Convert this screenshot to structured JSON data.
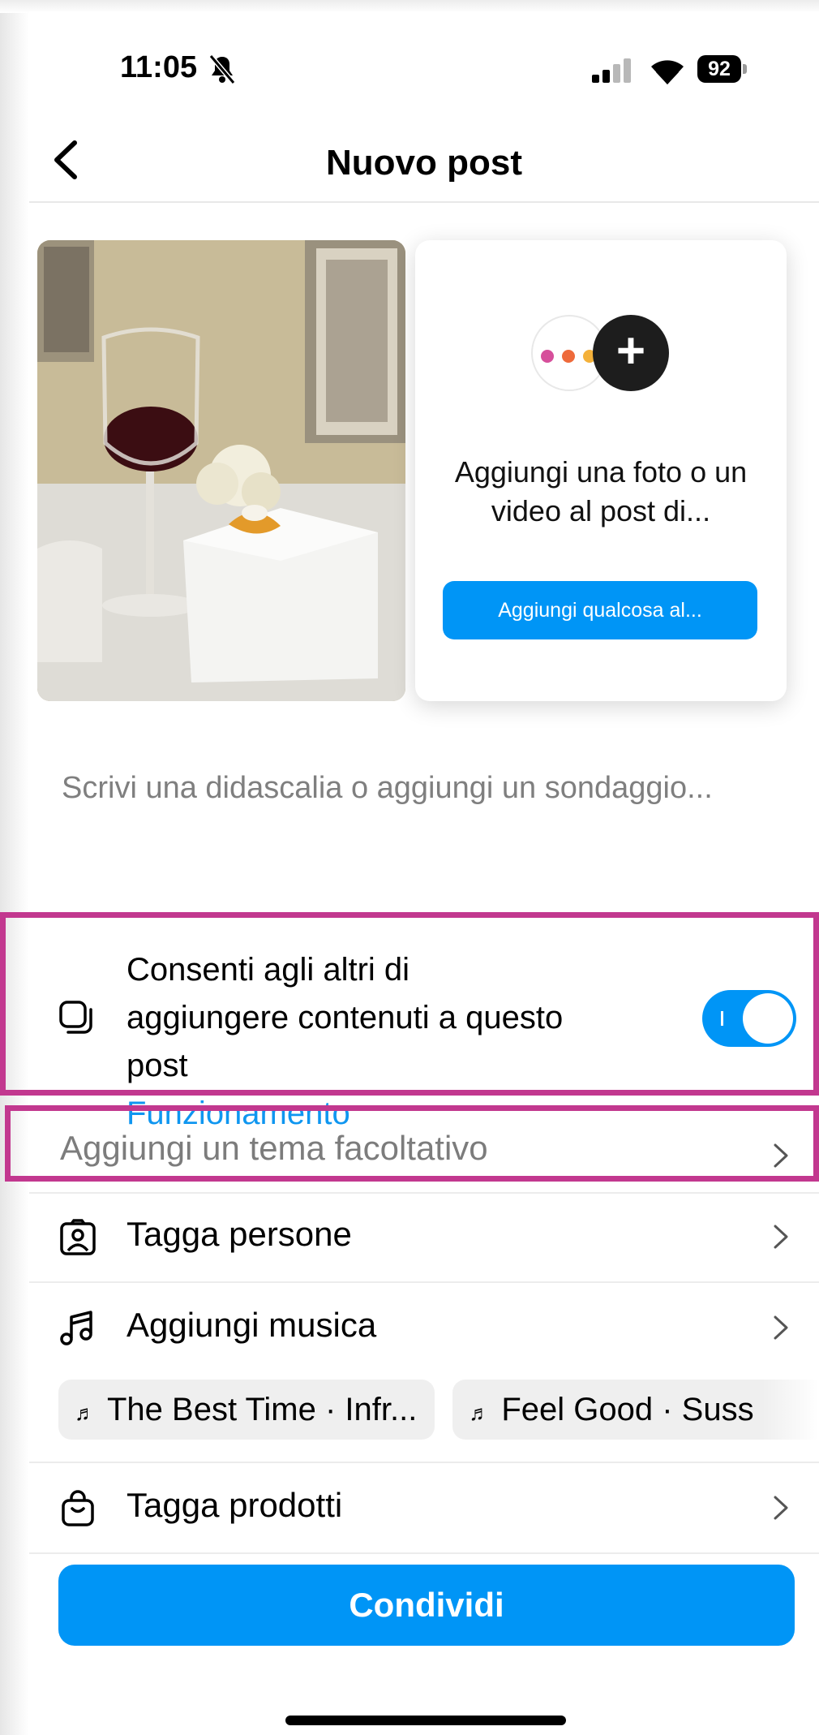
{
  "status_bar": {
    "time": "11:05",
    "battery": "92"
  },
  "header": {
    "title": "Nuovo post"
  },
  "add_card": {
    "text": "Aggiungi una foto o un video al post di...",
    "button_label": "Aggiungi qualcosa al..."
  },
  "caption": {
    "placeholder": "Scrivi una didascalia o aggiungi un sondaggio..."
  },
  "collab": {
    "label": "Consenti agli altri di aggiungere contenuti a questo post",
    "link": "Funzionamento",
    "enabled": true
  },
  "rows": {
    "theme": "Aggiungi un tema facoltativo",
    "tag_people": "Tagga persone",
    "add_music": "Aggiungi musica",
    "tag_products": "Tagga prodotti"
  },
  "music_suggestions": [
    "The Best Time · Infr...",
    "Feel Good · Suss"
  ],
  "share_button": "Condividi",
  "colors": {
    "accent": "#0095f6",
    "highlight": "#c2388f",
    "link": "#0f96f0"
  }
}
